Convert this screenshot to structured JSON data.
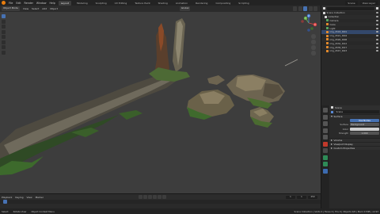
{
  "menubar": {
    "menus": [
      "File",
      "Edit",
      "Render",
      "Window",
      "Help"
    ],
    "workspaces": [
      "Layout",
      "Modeling",
      "Sculpting",
      "UV Editing",
      "Texture Paint",
      "Shading",
      "Animation",
      "Rendering",
      "Compositing",
      "Scripting"
    ],
    "active_workspace": "Layout",
    "scene": "Scene",
    "view_layer": "View Layer"
  },
  "viewport_header": {
    "mode": "Object Mode",
    "menus": [
      "View",
      "Select",
      "Add",
      "Object"
    ],
    "orientation": "Global"
  },
  "gizmo": {
    "x": "X",
    "y": "Y",
    "z": "Z"
  },
  "outliner": {
    "title": "Scene Collection",
    "items": [
      {
        "label": "Scene Collection",
        "icon": "white",
        "selected": false
      },
      {
        "label": "Collection",
        "icon": "white",
        "selected": false
      },
      {
        "label": "Camera",
        "icon": "green",
        "selected": false
      },
      {
        "label": "Cube",
        "icon": "orange",
        "selected": false
      },
      {
        "label": "Light",
        "icon": "green",
        "selected": false
      },
      {
        "label": "img_4518_t001",
        "icon": "orange",
        "selected": true
      },
      {
        "label": "img_4521_t004",
        "icon": "orange",
        "selected": false
      },
      {
        "label": "img_4526_t008",
        "icon": "orange",
        "selected": false
      },
      {
        "label": "img_4532_t012",
        "icon": "orange",
        "selected": false
      },
      {
        "label": "img_4539_t017",
        "icon": "orange",
        "selected": false
      },
      {
        "label": "img_4547_t023",
        "icon": "orange",
        "selected": false
      }
    ]
  },
  "properties": {
    "header_title": "Scene",
    "object_name": "Scene",
    "sections": [
      "Surface",
      "Volume",
      "Viewport Display",
      "Custom Properties"
    ],
    "surface_value": "Use Nodes",
    "rows": [
      {
        "label": "Surface",
        "value": "Background"
      },
      {
        "label": "Color",
        "value": ""
      },
      {
        "label": "Strength",
        "value": "1.000"
      }
    ]
  },
  "timeline": {
    "menus": [
      "Playback",
      "Keying",
      "View",
      "Marker"
    ],
    "current_frame": "1",
    "start": "1",
    "end": "250"
  },
  "statusbar": {
    "left": "Select",
    "middle": "Rotate View",
    "right": "Object Context Menu",
    "stats": "Scene Collection | Verts 0 | Faces 0 | Tris 0 | Objects 0/6 | Mem 0 MiB | v2.93"
  },
  "colors": {
    "accent": "#4772b3",
    "viewport_bg": "#3d3d3d",
    "panel_bg": "#282828",
    "logo": "#e87d0d"
  }
}
